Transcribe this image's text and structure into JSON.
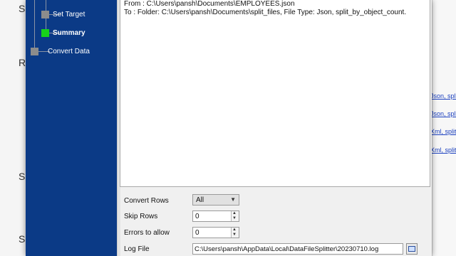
{
  "background": {
    "left_letters": [
      "S",
      "R",
      "S",
      "S"
    ],
    "right_links": [
      "Json, spli",
      "Json, spli",
      "Xml, split",
      "Xml, split"
    ]
  },
  "wizard": {
    "steps": [
      {
        "label": "Set Target",
        "active": false
      },
      {
        "label": "Summary",
        "active": true
      },
      {
        "label": "Convert Data",
        "active": false
      }
    ]
  },
  "summary": {
    "lines": [
      "From : C:\\Users\\pansh\\Documents\\EMPLOYEES.json",
      "To : Folder: C:\\Users\\pansh\\Documents\\split_files, File Type: Json, split_by_object_count."
    ]
  },
  "options": {
    "convert_rows": {
      "label": "Convert Rows",
      "value": "All"
    },
    "skip_rows": {
      "label": "Skip Rows",
      "value": "0"
    },
    "errors_to_allow": {
      "label": "Errors to allow",
      "value": "0"
    },
    "log_file": {
      "label": "Log File",
      "value": "C:\\Users\\pansh\\AppData\\Local\\DataFileSplitter\\20230710.log"
    }
  },
  "colors": {
    "wizard_panel": "#0b3a86",
    "active_step": "#17d21a",
    "inactive_step": "#8c8c8c",
    "link": "#1a3fbf"
  }
}
